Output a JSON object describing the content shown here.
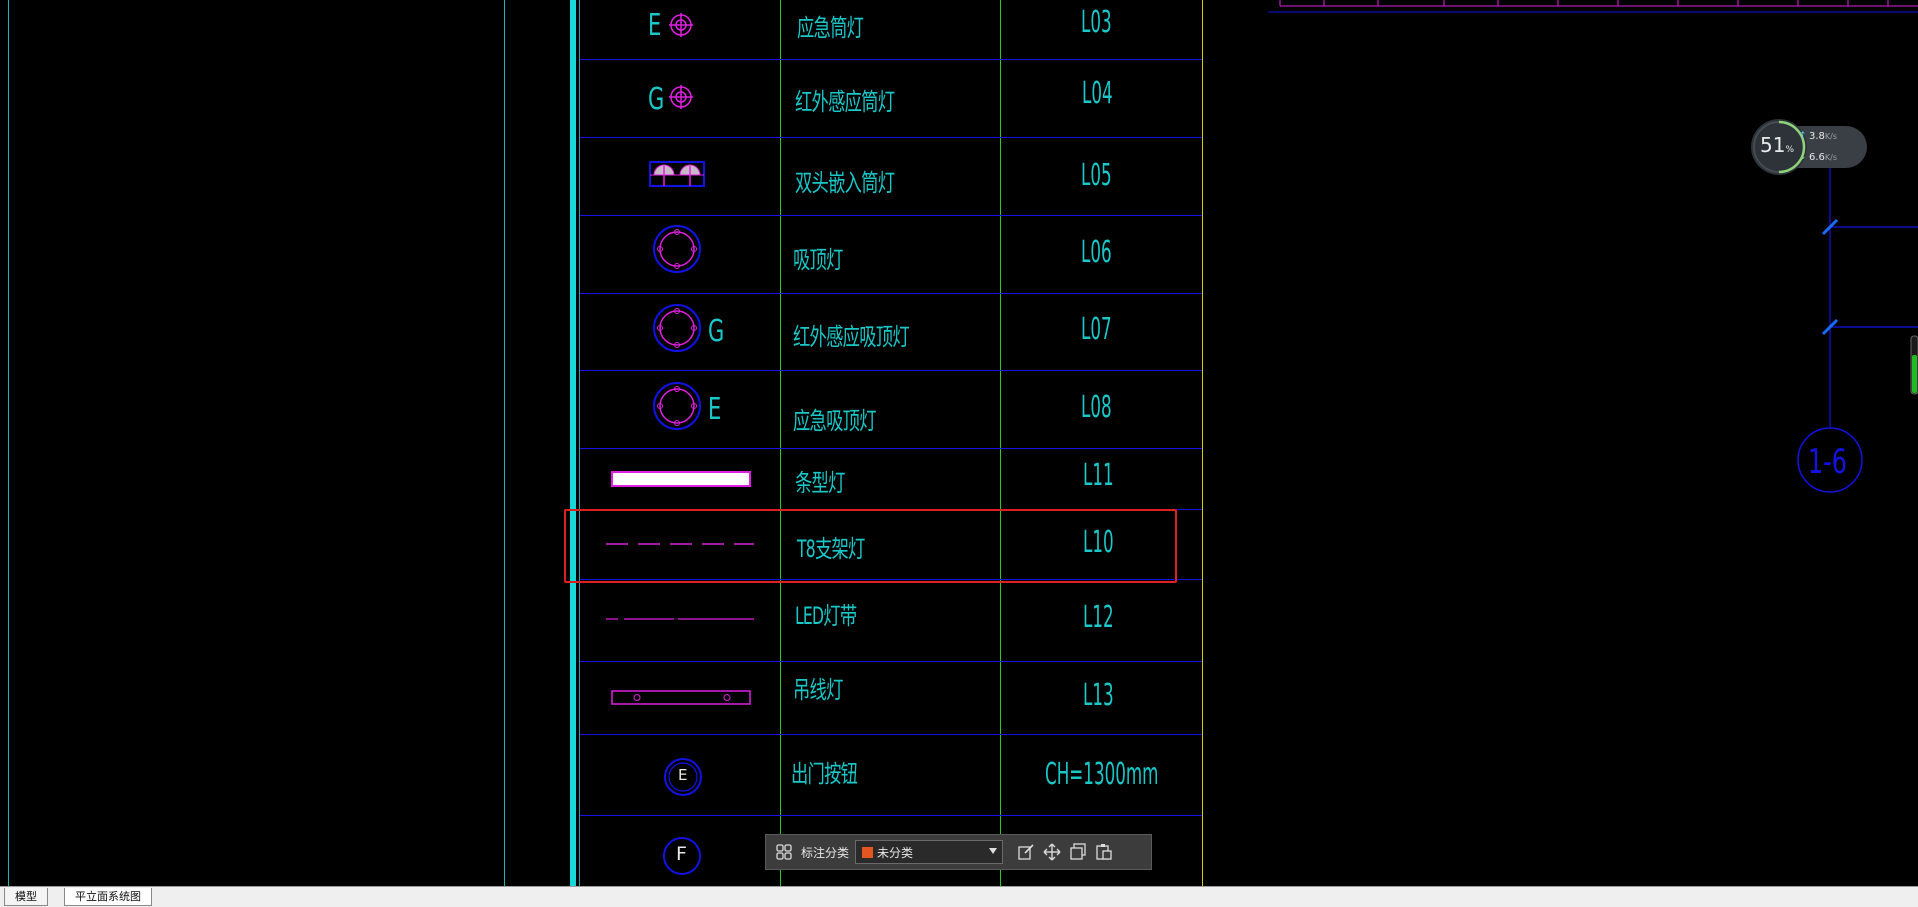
{
  "legend_rows": [
    {
      "symbol": "emergency-downlight-symbol",
      "letter": "E",
      "name": "应急筒灯",
      "code": "L03"
    },
    {
      "symbol": "infrared-downlight-symbol",
      "letter": "G",
      "name": "红外感应筒灯",
      "code": "L04"
    },
    {
      "symbol": "double-recessed-downlight-symbol",
      "letter": "",
      "name": "双头嵌入筒灯",
      "code": "L05"
    },
    {
      "symbol": "ceiling-light-symbol",
      "letter": "",
      "name": "吸顶灯",
      "code": "L06"
    },
    {
      "symbol": "infrared-ceiling-light-symbol",
      "letter": "G",
      "name": "红外感应吸顶灯",
      "code": "L07"
    },
    {
      "symbol": "emergency-ceiling-light-symbol",
      "letter": "E",
      "name": "应急吸顶灯",
      "code": "L08"
    },
    {
      "symbol": "strip-light-symbol",
      "letter": "",
      "name": "条型灯",
      "code": "L11"
    },
    {
      "symbol": "t8-bracket-light-symbol",
      "letter": "",
      "name": "T8支架灯",
      "code": "L10"
    },
    {
      "symbol": "led-strip-symbol",
      "letter": "",
      "name": "LED灯带",
      "code": "L12"
    },
    {
      "symbol": "pendant-light-symbol",
      "letter": "",
      "name": "吊线灯",
      "code": "L13"
    },
    {
      "symbol": "exit-button-symbol",
      "letter": "E",
      "name": "出门按钮",
      "code": "CH=1300mm"
    },
    {
      "symbol": "fire-symbol",
      "letter": "F",
      "name": "",
      "code": ""
    }
  ],
  "grid_bubble": {
    "label": "1-6"
  },
  "speed_widget": {
    "percent": "51",
    "percent_unit": "%",
    "upload": "3.8",
    "download": "6.6",
    "unit": "K/s"
  },
  "toolbar": {
    "label": "标注分类",
    "selected": "未分类"
  },
  "tabs": [
    {
      "label": "模型",
      "active": false
    },
    {
      "label": "平立面系统图",
      "active": true
    }
  ],
  "colors": {
    "cyan": "#19c8c8",
    "blue": "#1212e6",
    "green": "#22cc22",
    "yellow": "#cccc00",
    "magenta": "#e020e0",
    "highlight": "#e02020"
  }
}
